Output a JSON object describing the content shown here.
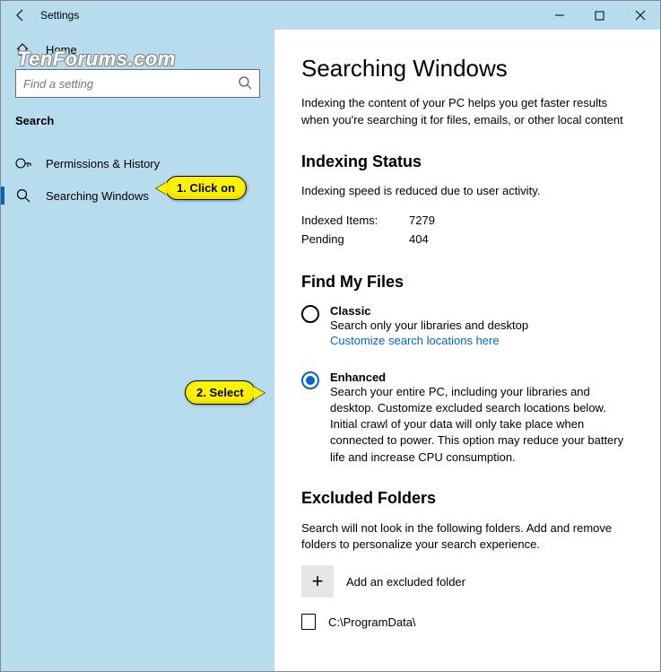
{
  "window": {
    "title": "Settings"
  },
  "watermark": "TenForums.com",
  "sidebar": {
    "home_label": "Home",
    "search_placeholder": "Find a setting",
    "section_label": "Search",
    "items": [
      {
        "label": "Permissions & History"
      },
      {
        "label": "Searching Windows"
      }
    ]
  },
  "callouts": {
    "c1": "1. Click on",
    "c2": "2. Select"
  },
  "page": {
    "title": "Searching Windows",
    "description": "Indexing the content of your PC helps you get faster results when you're searching it for files, emails, or other local content",
    "indexing": {
      "heading": "Indexing Status",
      "status": "Indexing speed is reduced due to user activity.",
      "indexed_label": "Indexed Items:",
      "indexed_value": "7279",
      "pending_label": "Pending",
      "pending_value": "404"
    },
    "findfiles": {
      "heading": "Find My Files",
      "classic": {
        "title": "Classic",
        "desc": "Search only your libraries and desktop",
        "link": "Customize search locations here"
      },
      "enhanced": {
        "title": "Enhanced",
        "desc": "Search your entire PC, including your libraries and desktop. Customize excluded search locations below. Initial crawl of your data will only take place when connected to power. This option may reduce your battery life and increase CPU consumption."
      }
    },
    "excluded": {
      "heading": "Excluded Folders",
      "desc": "Search will not look in the following folders. Add and remove folders to personalize your search experience.",
      "add_label": "Add an excluded folder",
      "folder1": "C:\\ProgramData\\"
    }
  }
}
